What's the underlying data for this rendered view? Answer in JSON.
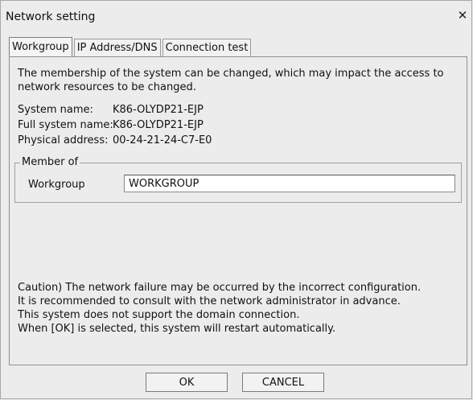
{
  "window": {
    "title": "Network setting",
    "close_symbol": "✕"
  },
  "tabs": [
    {
      "label": "Workgroup",
      "active": true
    },
    {
      "label": "IP Address/DNS",
      "active": false
    },
    {
      "label": "Connection test",
      "active": false
    }
  ],
  "workgroup_tab": {
    "intro": "The membership of the system can be changed, which may impact the access to network resources to be changed.",
    "system_name_label": "System name:",
    "system_name_value": "K86-OLYDP21-EJP",
    "full_system_name_label": "Full system name:",
    "full_system_name_value": "K86-OLYDP21-EJP",
    "physical_address_label": "Physical address:",
    "physical_address_value": "00-24-21-24-C7-E0",
    "member_of": {
      "legend": "Member of",
      "workgroup_label": "Workgroup",
      "workgroup_value": "WORKGROUP"
    },
    "caution_lines": [
      "Caution) The network failure may be occurred by the incorrect configuration.",
      "It is recommended to consult with the network administrator in advance.",
      "This system does not support the domain connection.",
      "When [OK] is selected, this system will restart automatically."
    ]
  },
  "buttons": {
    "ok_label": "OK",
    "cancel_label": "CANCEL"
  }
}
